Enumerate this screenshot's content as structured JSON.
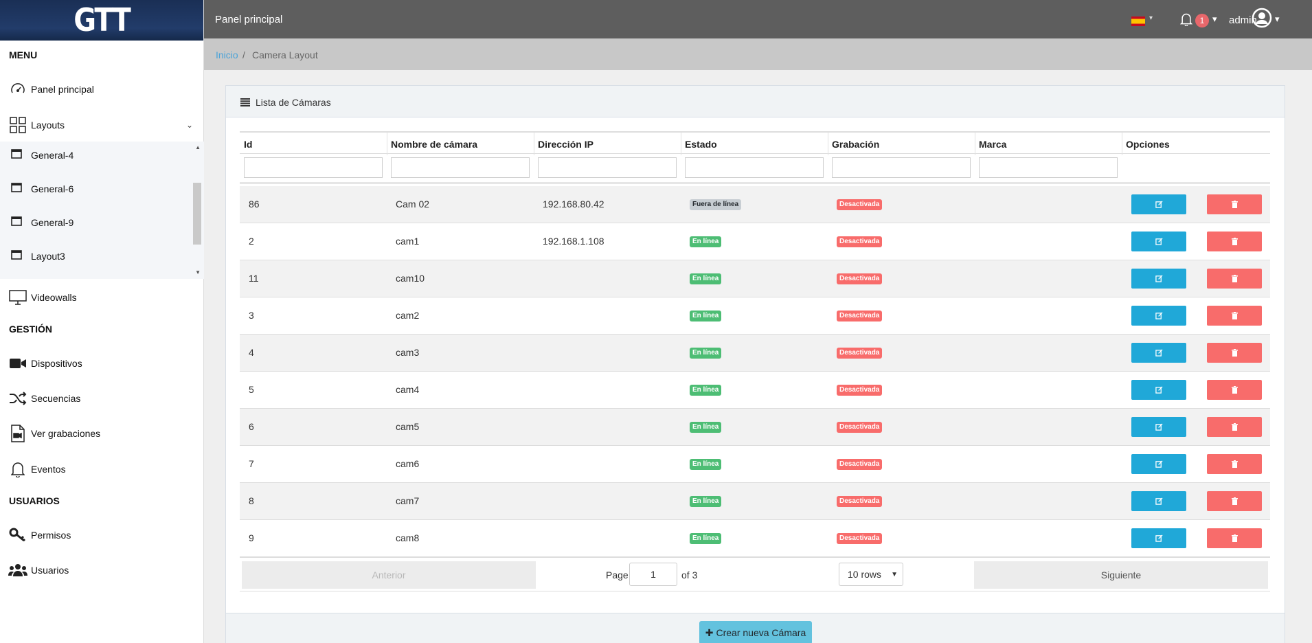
{
  "brand": "GTT",
  "topbar": {
    "title": "Panel principal",
    "notifications": "1",
    "user": "admin"
  },
  "breadcrumb": {
    "home": "Inicio",
    "separator": "/",
    "current": "Camera Layout"
  },
  "sidebar": {
    "sections": {
      "menu": "MENU",
      "gestion": "GESTIÓN",
      "usuarios": "USUARIOS"
    },
    "items": {
      "panel": "Panel principal",
      "layouts": "Layouts",
      "videowalls": "Videowalls",
      "dispositivos": "Dispositivos",
      "secuencias": "Secuencias",
      "grabaciones": "Ver grabaciones",
      "eventos": "Eventos",
      "permisos": "Permisos",
      "usuarios": "Usuarios"
    },
    "layouts_sub": [
      "General-4",
      "General-6",
      "General-9",
      "Layout3"
    ]
  },
  "card": {
    "title": "Lista de Cámaras"
  },
  "table": {
    "headers": [
      "Id",
      "Nombre de cámara",
      "Dirección IP",
      "Estado",
      "Grabación",
      "Marca",
      "Opciones"
    ],
    "rows": [
      {
        "id": "86",
        "name": "Cam 02",
        "ip": "192.168.80.42",
        "estado": "Fuera de línea",
        "grabacion": "Desactivada"
      },
      {
        "id": "2",
        "name": "cam1",
        "ip": "192.168.1.108",
        "estado": "En línea",
        "grabacion": "Desactivada"
      },
      {
        "id": "11",
        "name": "cam10",
        "ip": "",
        "estado": "En línea",
        "grabacion": "Desactivada"
      },
      {
        "id": "3",
        "name": "cam2",
        "ip": "",
        "estado": "En línea",
        "grabacion": "Desactivada"
      },
      {
        "id": "4",
        "name": "cam3",
        "ip": "",
        "estado": "En línea",
        "grabacion": "Desactivada"
      },
      {
        "id": "5",
        "name": "cam4",
        "ip": "",
        "estado": "En línea",
        "grabacion": "Desactivada"
      },
      {
        "id": "6",
        "name": "cam5",
        "ip": "",
        "estado": "En línea",
        "grabacion": "Desactivada"
      },
      {
        "id": "7",
        "name": "cam6",
        "ip": "",
        "estado": "En línea",
        "grabacion": "Desactivada"
      },
      {
        "id": "8",
        "name": "cam7",
        "ip": "",
        "estado": "En línea",
        "grabacion": "Desactivada"
      },
      {
        "id": "9",
        "name": "cam8",
        "ip": "",
        "estado": "En línea",
        "grabacion": "Desactivada"
      }
    ]
  },
  "pagination": {
    "prev": "Anterior",
    "page_label": "Page",
    "page": "1",
    "of_label": "of 3",
    "rows": "10 rows",
    "next": "Siguiente"
  },
  "create_button": "Crear nueva Cámara",
  "colors": {
    "topbar": "#5e5e5e",
    "accent": "#20a8d8",
    "danger": "#f86c6b",
    "success": "#4dbd74"
  }
}
